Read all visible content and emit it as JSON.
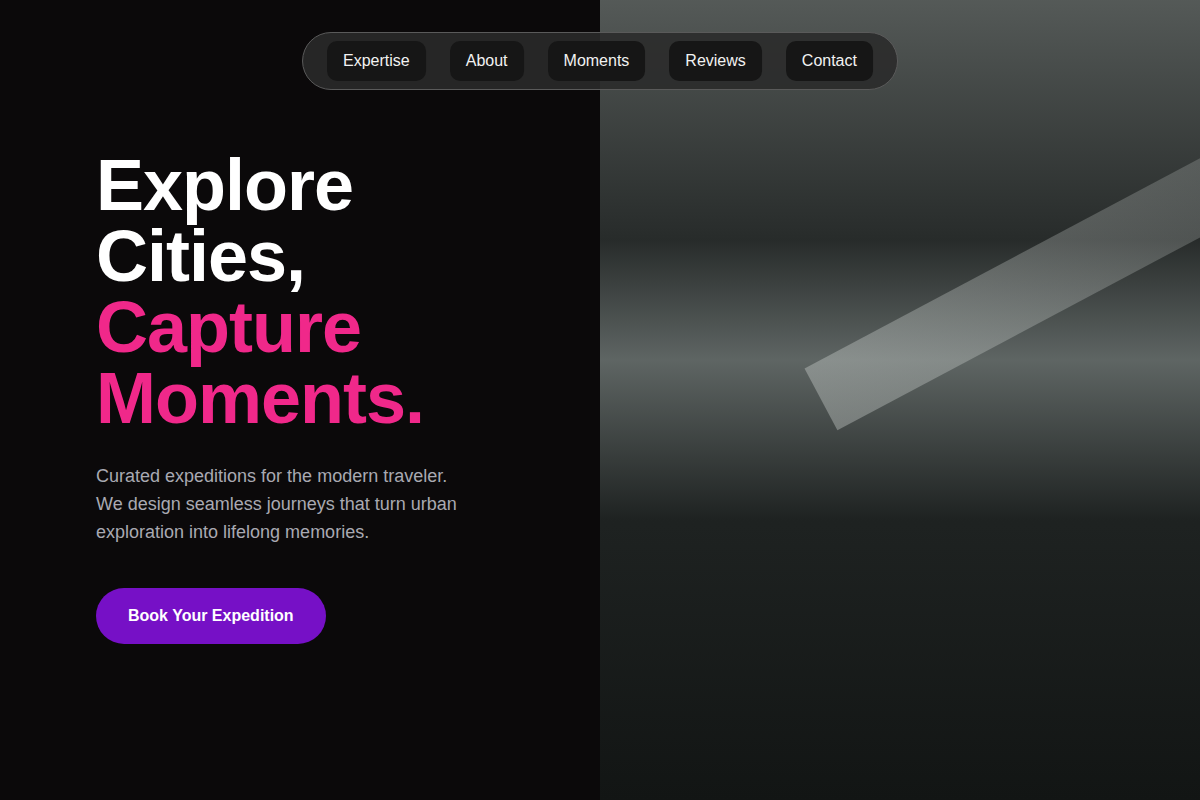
{
  "nav": {
    "items": [
      {
        "label": "Expertise"
      },
      {
        "label": "About"
      },
      {
        "label": "Moments"
      },
      {
        "label": "Reviews"
      },
      {
        "label": "Contact"
      }
    ]
  },
  "hero": {
    "headline": [
      {
        "text": "Explore",
        "accent": false
      },
      {
        "text": "Cities,",
        "accent": false
      },
      {
        "text": "Capture",
        "accent": true
      },
      {
        "text": "Moments.",
        "accent": true
      }
    ],
    "description": [
      "Curated expeditions for the modern traveler.",
      "We design seamless journeys that turn urban",
      "exploration into lifelong memories."
    ],
    "button": "Book Your Expedition"
  },
  "photo": {
    "kind": "architecture-photo"
  }
}
